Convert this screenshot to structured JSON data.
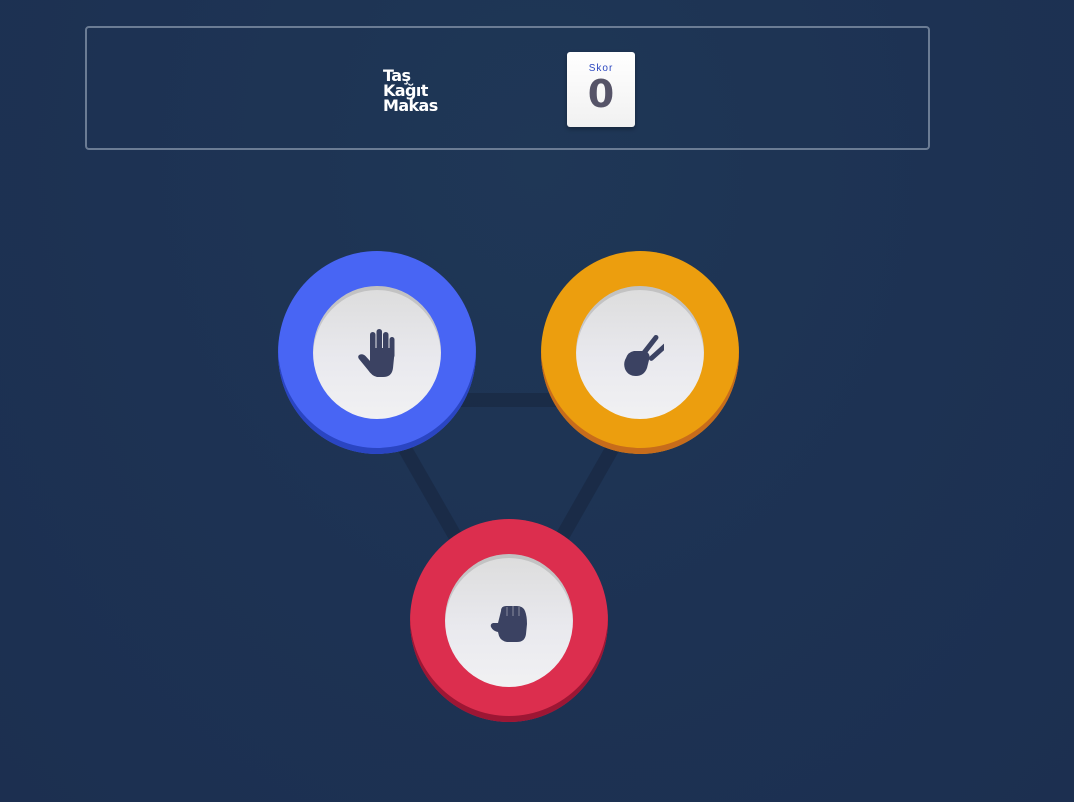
{
  "header": {
    "title_lines": [
      "Taş",
      "Kağıt",
      "Makas"
    ],
    "score_label": "Skor",
    "score_value": "0"
  },
  "choices": [
    {
      "id": "paper",
      "icon": "hand-paper-icon",
      "color": "#4865f4"
    },
    {
      "id": "scissors",
      "icon": "hand-scissors-icon",
      "color": "#ec9e0e"
    },
    {
      "id": "rock",
      "icon": "hand-rock-icon",
      "color": "#dc2e4e"
    }
  ],
  "colors": {
    "background": "#1f3756",
    "triangle_line": "#1a2a45",
    "icon": "#3b4262"
  }
}
